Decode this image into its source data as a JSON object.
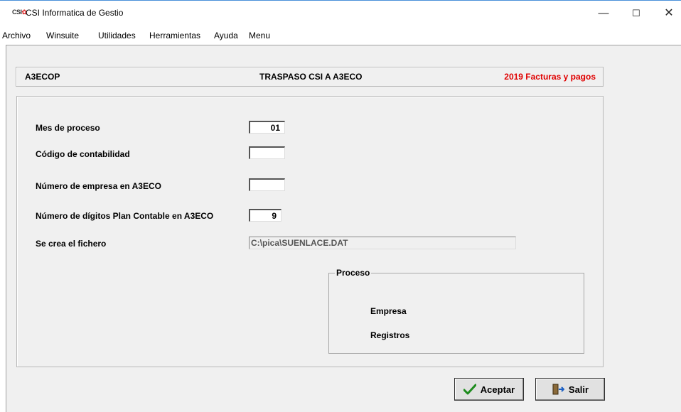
{
  "window": {
    "logo_text": "CSI",
    "title": "CSI Informatica de Gestio",
    "minimize_glyph": "—",
    "maximize_glyph": "☐",
    "close_glyph": "✕"
  },
  "menu": [
    "Archivo",
    "Winsuite",
    "Utilidades",
    "Herramientas",
    "Ayuda",
    "Menu"
  ],
  "header": {
    "left": "A3ECOP",
    "center": "TRASPASO CSI A A3ECO",
    "right": "2019 Facturas y pagos",
    "right_color": "#e00000"
  },
  "form": {
    "mes_label": "Mes de proceso",
    "mes_value": "01",
    "codigo_label": "Código de contabilidad",
    "codigo_value": "",
    "empresa_label": "Número de empresa en A3ECO",
    "empresa_value": "",
    "digitos_label": "Número de dígitos Plan Contable en A3ECO",
    "digitos_value": "9",
    "fichero_label": "Se crea el fichero",
    "fichero_value": "C:\\pica\\SUENLACE.DAT"
  },
  "proceso": {
    "title": "Proceso",
    "empresa": "Empresa",
    "registros": "Registros"
  },
  "buttons": {
    "aceptar": "Aceptar",
    "aceptar_icon": "checkmark-icon",
    "salir": "Salir",
    "salir_icon": "exit-door-icon"
  }
}
